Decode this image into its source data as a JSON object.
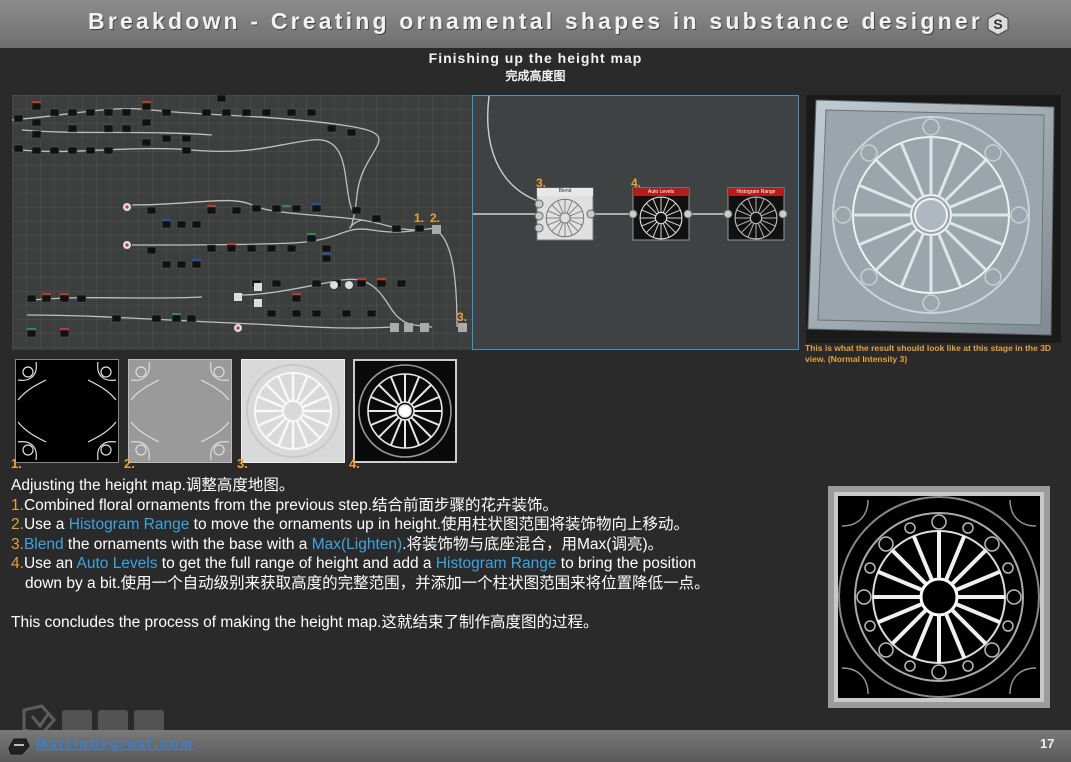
{
  "header": {
    "title": "Breakdown - Creating ornamental shapes in substance designer",
    "subtitle": "Finishing up the height map",
    "subtitle_cn": "完成高度图"
  },
  "graph": {
    "labels": [
      "1.",
      "2.",
      "3."
    ]
  },
  "zoom": {
    "node_labels": [
      "3.",
      "4."
    ],
    "nodes": [
      "Blend",
      "Auto Levels",
      "Histogram Range"
    ]
  },
  "render": {
    "caption": "This is what the result should look like at this stage in the 3D view. (Normal Intensity 3)"
  },
  "thumbnails": {
    "labels": [
      "1.",
      "2.",
      "3.",
      "4."
    ]
  },
  "body": {
    "intro": "Adjusting the height map.调整高度地图。",
    "step1_num": "1.",
    "step1_text": "Combined floral ornaments from the previous step.结合前面步骤的花卉装饰。",
    "step2_num": "2.",
    "step2_a": "Use a ",
    "step2_hl": "Histogram Range",
    "step2_b": " to move the ornaments up in height.使用柱状图范围将装饰物向上移动。",
    "step3_num": "3.",
    "step3_hl": "Blend",
    "step3_a": " the ornaments with the base with a ",
    "step3_hl2": "Max(Lighten)",
    "step3_b": ".将装饰物与底座混合，用Max(调亮)。",
    "step4_num": "4.",
    "step4_a": "Use an ",
    "step4_hl": "Auto Levels",
    "step4_b": " to get the full range of height and add a ",
    "step4_hl2": "Histogram Range",
    "step4_c": " to bring the position",
    "step4_line2": "down by a bit.使用一个自动级别来获取高度的完整范围，并添加一个柱状图范围来将位置降低一点。",
    "conclusion": "This concludes the process of making the height map.这就结束了制作高度图的过程。"
  },
  "footer": {
    "link": "Martindegraaf.com",
    "page": "17"
  },
  "colors": {
    "accent_orange": "#e8a138",
    "highlight_blue": "#3ea4e0",
    "panel_border": "#3a95c7"
  }
}
